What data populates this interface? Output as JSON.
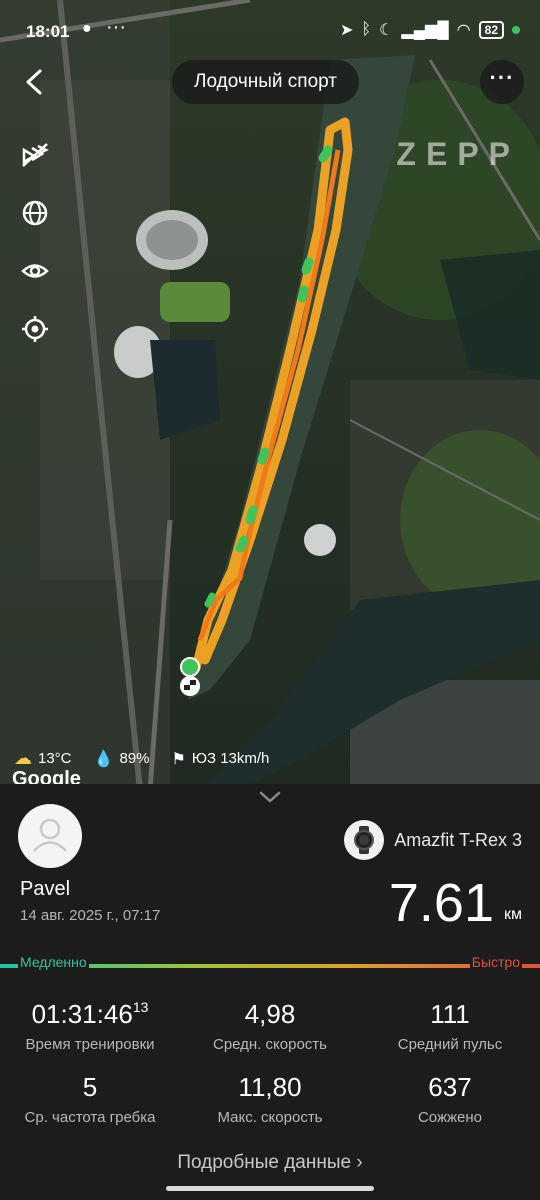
{
  "status_bar": {
    "time": "18:01",
    "extra_dots": "···",
    "battery": "82"
  },
  "header": {
    "title": "Лодочный спорт",
    "back_icon": "chevron-left-icon",
    "more_icon": "more-dots-icon",
    "more_label": "···"
  },
  "map": {
    "brand_logo": "ZEPP",
    "google_logo": "Google",
    "tools": [
      "layers-icon",
      "globe-icon",
      "eye-icon",
      "target-icon"
    ],
    "route_colors": {
      "main": "#f5a623",
      "fast": "#f07a1a",
      "slow": "#3ec45a"
    },
    "weather": {
      "temperature": "13°C",
      "humidity": "89%",
      "wind": "ЮЗ 13km/h"
    }
  },
  "summary": {
    "user_name": "Pavel",
    "date": "14 авг. 2025 г., 07:17",
    "device_name": "Amazfit T-Rex 3",
    "distance_value": "7.61",
    "distance_unit": "км",
    "pace_slow_label": "Медленно",
    "pace_fast_label": "Быстро",
    "stats": [
      {
        "value": "01:31:46",
        "sup": "13",
        "label": "Время тренировки"
      },
      {
        "value": "4,98",
        "label": "Средн. скорость"
      },
      {
        "value": "111",
        "label": "Средний пульс"
      },
      {
        "value": "5",
        "label": "Ср. частота гребка"
      },
      {
        "value": "11,80",
        "label": "Макс. скорость"
      },
      {
        "value": "637",
        "label": "Сожжено"
      }
    ],
    "details_link": "Подробные данные ›"
  }
}
